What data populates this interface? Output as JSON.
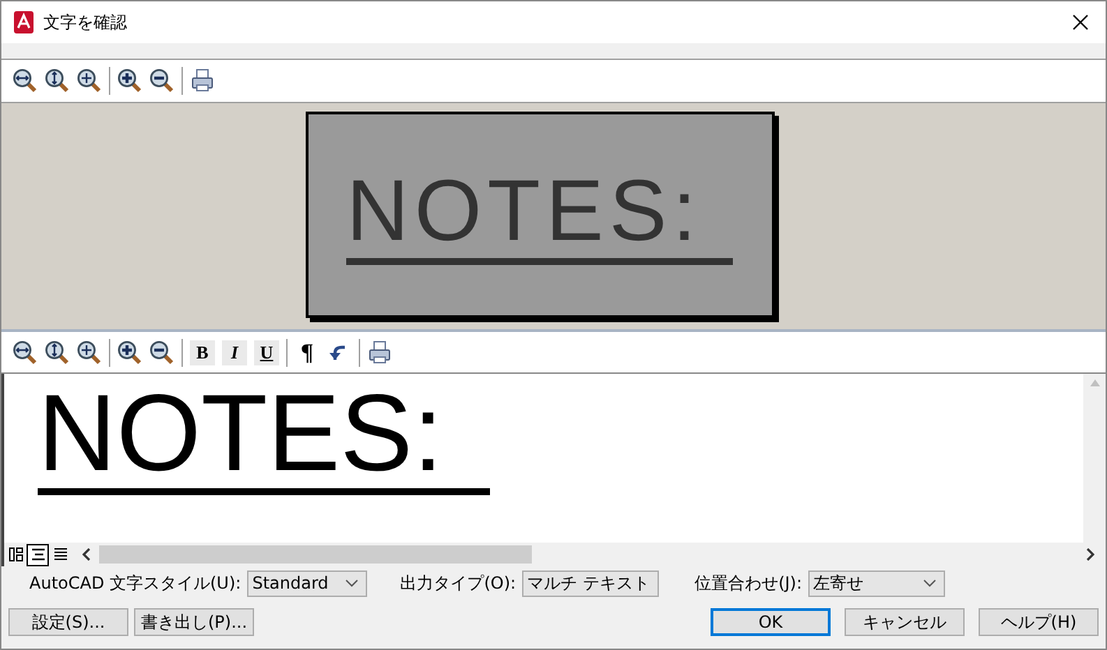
{
  "window": {
    "title": "文字を確認"
  },
  "preview_toolbar": [
    {
      "kind": "zoomwidth"
    },
    {
      "kind": "zoomheight"
    },
    {
      "kind": "zoomfit"
    },
    {
      "kind": "separator"
    },
    {
      "kind": "zoomin"
    },
    {
      "kind": "zoomout"
    },
    {
      "kind": "separator"
    },
    {
      "kind": "print"
    }
  ],
  "scan_preview": {
    "text": "NOTES:"
  },
  "editor_toolbar": [
    {
      "kind": "zoomwidth"
    },
    {
      "kind": "zoomheight"
    },
    {
      "kind": "zoomfit"
    },
    {
      "kind": "separator"
    },
    {
      "kind": "zoomin"
    },
    {
      "kind": "zoomout"
    },
    {
      "kind": "separator"
    },
    {
      "kind": "bold",
      "label": "B"
    },
    {
      "kind": "italic",
      "label": "I"
    },
    {
      "kind": "underline",
      "label": "U"
    },
    {
      "kind": "separator"
    },
    {
      "kind": "pilcrow",
      "label": "¶"
    },
    {
      "kind": "undo"
    },
    {
      "kind": "separator"
    },
    {
      "kind": "print"
    }
  ],
  "editor": {
    "text": "NOTES:"
  },
  "view_modes": [
    {
      "selected": false
    },
    {
      "selected": true
    },
    {
      "selected": false
    }
  ],
  "options": [
    {
      "label": "AutoCAD 文字スタイル(U):",
      "value": "Standard"
    },
    {
      "label": "出力タイプ(O):",
      "value": "マルチ テキスト"
    },
    {
      "label": "位置合わせ(J):",
      "value": "左寄せ"
    }
  ],
  "left_buttons": [
    "設定(S)...",
    "書き出し(P)..."
  ],
  "right_buttons": [
    {
      "label": "OK",
      "default": true
    },
    {
      "label": "キャンセル",
      "default": false
    },
    {
      "label": "ヘルプ(H)",
      "default": false
    }
  ]
}
